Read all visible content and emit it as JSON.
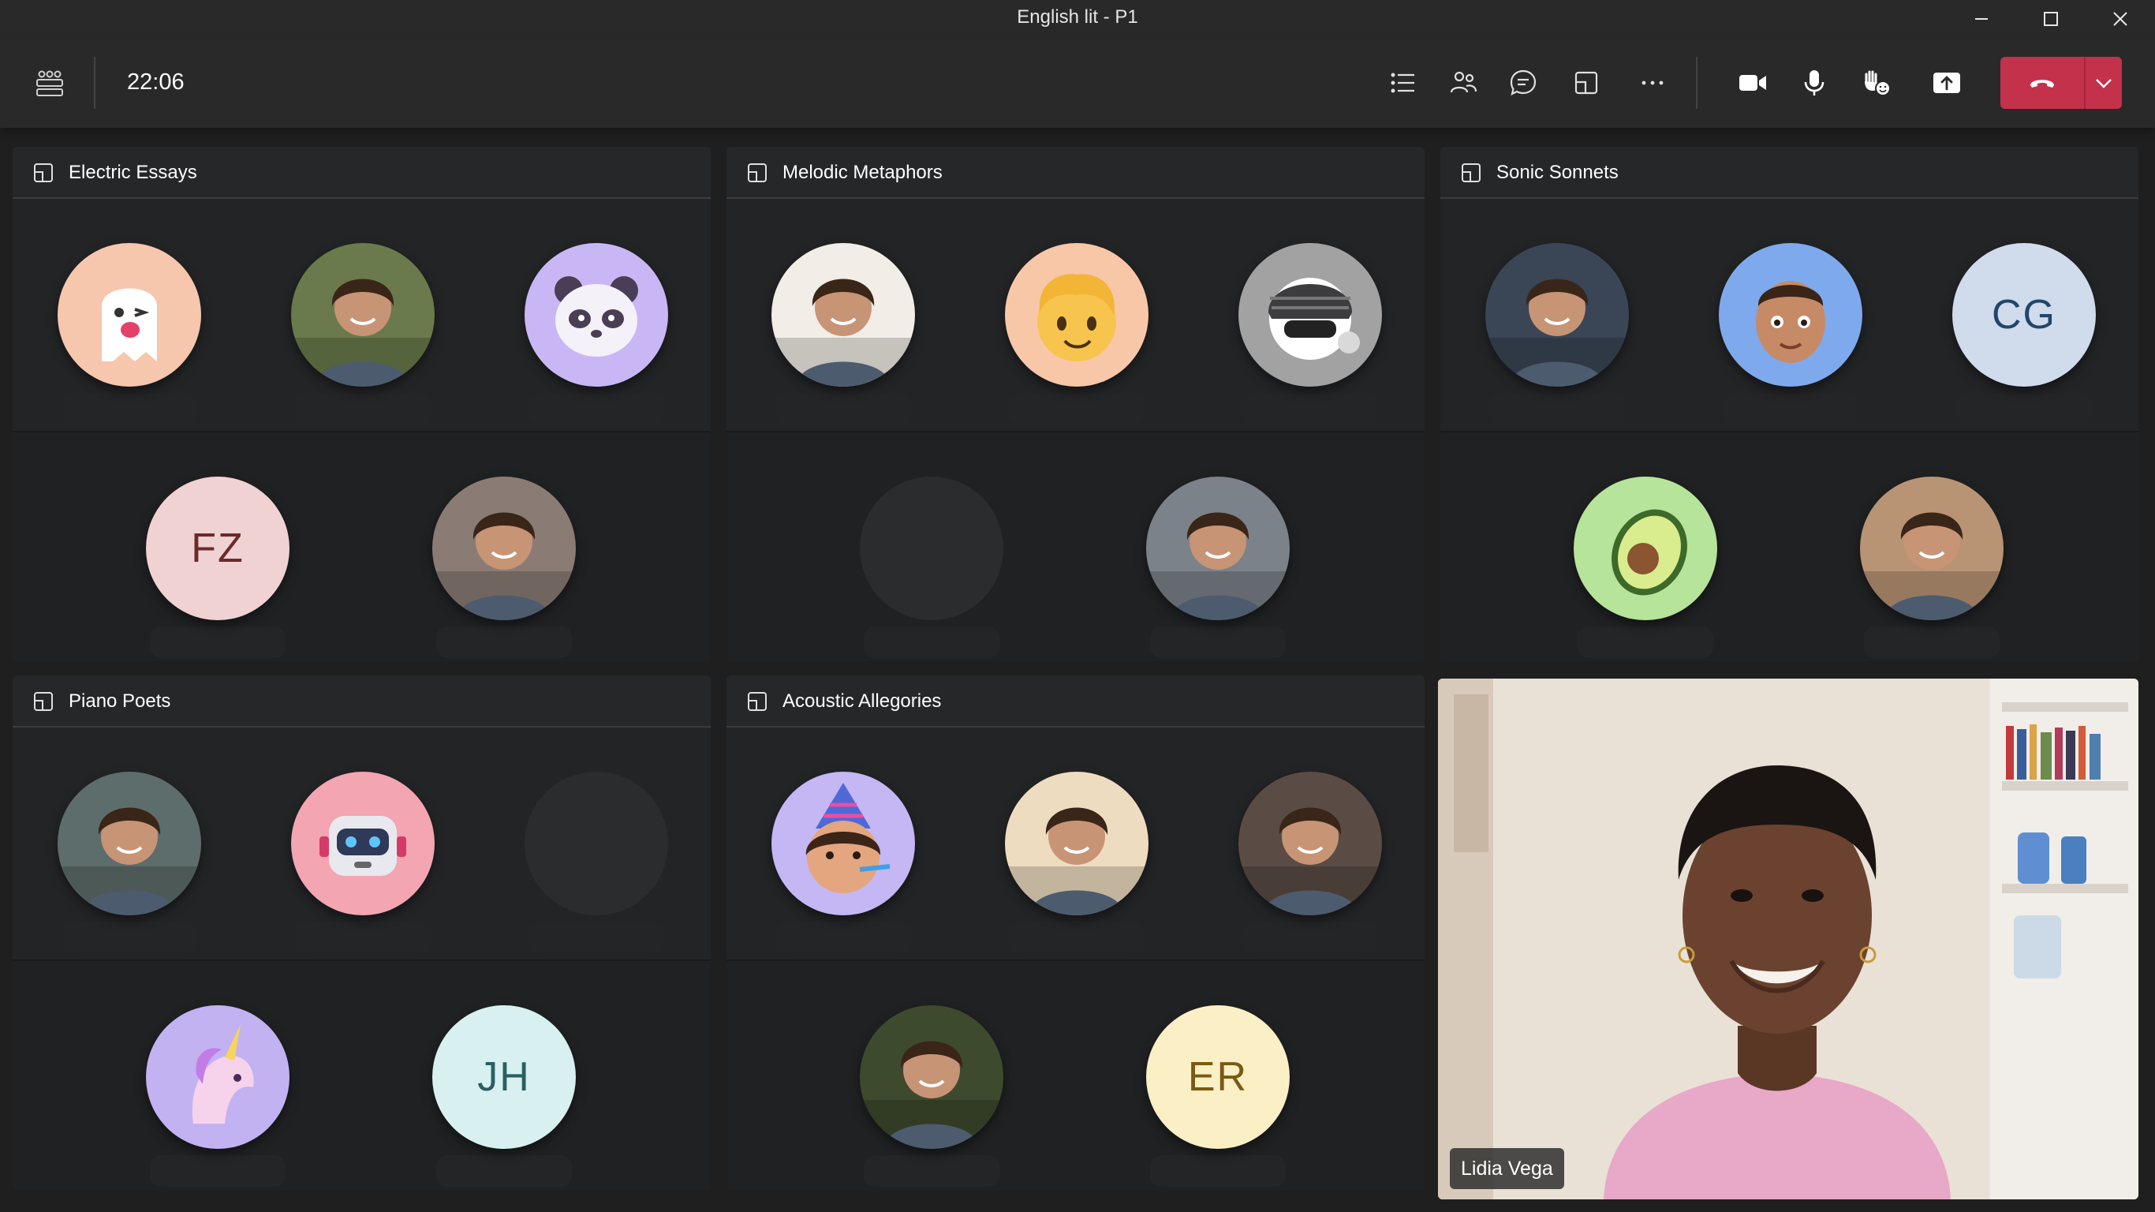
{
  "window": {
    "title": "English lit - P1"
  },
  "toolbar": {
    "time": "22:06",
    "icons": [
      "rooms-icon",
      "list-icon",
      "people-icon",
      "chat-icon",
      "breakout-icon",
      "more-icon",
      "camera-icon",
      "mic-icon",
      "raise-hand-icon",
      "share-icon",
      "hang-up-icon",
      "chevron-down-icon"
    ]
  },
  "colors": {
    "accent": "#c4314b",
    "background": "#1f1f1f",
    "titlebar": "#292929",
    "room": "#252526"
  },
  "rooms": [
    {
      "name": "Electric Essays",
      "participants": [
        {
          "type": "emoji",
          "icon": "ghost-icon",
          "bg": "#f6c6ad"
        },
        {
          "type": "photo",
          "icon": "person-photo",
          "bg": "#6a7a4c"
        },
        {
          "type": "emoji",
          "icon": "panda-icon",
          "bg": "#c9b7f5"
        },
        {
          "type": "initials",
          "initials": "FZ",
          "bg": "#f0d2d2",
          "fg": "#6b2a2a"
        },
        {
          "type": "photo",
          "icon": "person-photo",
          "bg": "#8a7c74"
        }
      ]
    },
    {
      "name": "Melodic Metaphors",
      "participants": [
        {
          "type": "photo",
          "icon": "person-photo",
          "bg": "#f2ede6"
        },
        {
          "type": "emoji",
          "icon": "blond-face-icon",
          "bg": "#f8c7a8"
        },
        {
          "type": "emoji",
          "icon": "hat-character-icon",
          "bg": "#a2a2a2"
        },
        {
          "type": "empty"
        },
        {
          "type": "photo",
          "icon": "person-photo",
          "bg": "#7c8289"
        }
      ]
    },
    {
      "name": "Sonic Sonnets",
      "participants": [
        {
          "type": "photo",
          "icon": "person-photo",
          "bg": "#3a4656"
        },
        {
          "type": "emoji",
          "icon": "man-face-icon",
          "bg": "#7ea9ec"
        },
        {
          "type": "initials",
          "initials": "CG",
          "bg": "#d0dcec",
          "fg": "#22466b"
        },
        {
          "type": "emoji",
          "icon": "avocado-icon",
          "bg": "#b6e49a"
        },
        {
          "type": "photo",
          "icon": "person-photo",
          "bg": "#b89474"
        }
      ]
    },
    {
      "name": "Piano Poets",
      "participants": [
        {
          "type": "photo",
          "icon": "person-photo",
          "bg": "#5d6d6b"
        },
        {
          "type": "emoji",
          "icon": "robot-icon",
          "bg": "#f3a5b2"
        },
        {
          "type": "empty"
        },
        {
          "type": "emoji",
          "icon": "unicorn-icon",
          "bg": "#c2b2f2"
        },
        {
          "type": "initials",
          "initials": "JH",
          "bg": "#d8f0f0",
          "fg": "#2b5f62"
        }
      ]
    },
    {
      "name": "Acoustic Allegories",
      "participants": [
        {
          "type": "emoji",
          "icon": "party-girl-icon",
          "bg": "#c5b7f4"
        },
        {
          "type": "photo",
          "icon": "person-photo",
          "bg": "#eedcc0"
        },
        {
          "type": "photo",
          "icon": "person-photo",
          "bg": "#5a4c44"
        },
        {
          "type": "photo",
          "icon": "person-photo",
          "bg": "#3e4a2e"
        },
        {
          "type": "initials",
          "initials": "ER",
          "bg": "#fbefc6",
          "fg": "#7a5a12"
        }
      ]
    }
  ],
  "video": {
    "name": "Lidia Vega"
  }
}
